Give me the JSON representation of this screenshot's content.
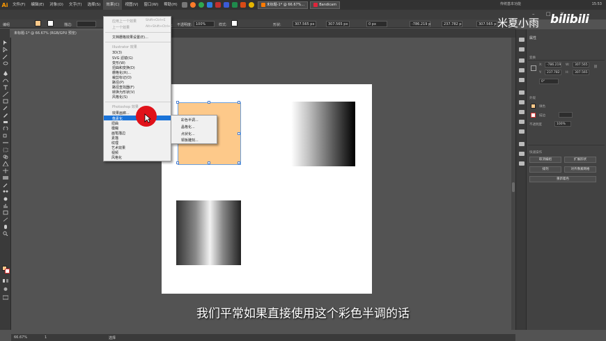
{
  "menubar": {
    "logo": "Ai",
    "items": [
      "文件(F)",
      "编辑(E)",
      "对象(O)",
      "文字(T)",
      "选择(S)",
      "效果(C)",
      "视图(V)",
      "窗口(W)",
      "帮助(H)"
    ],
    "tabs": [
      {
        "label": "未标题-1* @ 66.67%...",
        "color": "#ff7a00"
      },
      {
        "label": "Bandicam",
        "color": "#e0243a"
      }
    ],
    "workspace": "传统基本功能",
    "clock": "15:53"
  },
  "controlbar": {
    "selection_label": "编组",
    "stroke_label": "描边:",
    "opacity_label": "不透明度:",
    "opacity_value": "100%",
    "style_label": "样式:",
    "shape_label": "形状:",
    "w_value": "307.565 px",
    "h_value": "307.565 px",
    "angle_value": "0 px",
    "x_value": "-786.219 p",
    "y_value": "237.782 p",
    "w2_value": "307.565 p",
    "h2_value": "307.565 p"
  },
  "doctab": {
    "label": "未标题-1* @ 66.67% (RGB/GPU 预览)"
  },
  "effect_menu": {
    "apply_last": "应用上一个效果",
    "apply_last_sc": "Shift+Ctrl+E",
    "last_effect": "上一个效果",
    "last_effect_sc": "Alt+Shift+Ctrl+E",
    "doc_raster": "文档栅格效果设置(E)...",
    "illustrator_header": "Illustrator 效果",
    "illustrator_items": [
      "3D(3)",
      "SVG 滤镜(G)",
      "变形(W)",
      "扭曲和变换(D)",
      "栅格化(R)...",
      "裁剪标记(O)",
      "路径(P)",
      "路径查找器(F)",
      "转换为形状(V)",
      "风格化(S)"
    ],
    "photoshop_header": "Photoshop 效果",
    "photoshop_items": [
      "效果画廊...",
      "像素化",
      "扭曲",
      "模糊",
      "画笔描边",
      "素描",
      "纹理",
      "艺术效果",
      "视频",
      "风格化"
    ]
  },
  "submenu": {
    "items": [
      "彩色半调...",
      "晶格化...",
      "点状化...",
      "铜板雕刻..."
    ]
  },
  "properties": {
    "title": "属性",
    "section_transform": "变换",
    "x": "-786.219",
    "y": "237.782",
    "w": "307.565",
    "h": "307.565",
    "angle": "0°",
    "section_appearance": "外观",
    "fill_label": "填色",
    "stroke_label": "描边",
    "opacity_label": "不透明度",
    "opacity_value": "100%",
    "section_quick": "快速操作",
    "btn_ungroup": "取消编组",
    "btn_expand": "扩展形状",
    "btn_arrange": "排列",
    "btn_align": "对齐像素网格",
    "btn_recolor": "重新着色"
  },
  "statusbar": {
    "zoom": "66.67%",
    "page": "1",
    "tool": "选择"
  },
  "subtitle": "我们平常如果直接使用这个彩色半调的话",
  "watermark": {
    "cn": "米夏小雨",
    "bili": "bilibili"
  },
  "colors": {
    "fill": "#fdc98a",
    "accent": "#1a73d8",
    "cursor": "#e0121a"
  }
}
